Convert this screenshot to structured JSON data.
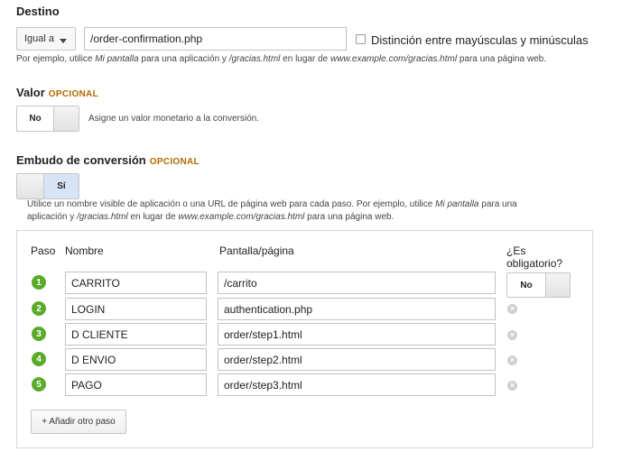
{
  "destination": {
    "title": "Destino",
    "match_type": "Igual a",
    "url_value": "/order-confirmation.php",
    "case_sensitive_label": "Distinción entre mayúsculas y minúsculas",
    "help_prefix": "Por ejemplo, utilice ",
    "help_em1": "Mi pantalla",
    "help_mid1": " para una aplicación y ",
    "help_em2": "/gracias.html",
    "help_mid2": " en lugar de ",
    "help_em3": "www.example.com/gracias.html",
    "help_suffix": " para una página web."
  },
  "value": {
    "title": "Valor",
    "optional": "OPCIONAL",
    "toggle_label": "No",
    "help": "Asigne un valor monetario a la conversión."
  },
  "funnel": {
    "title": "Embudo de conversión",
    "optional": "OPCIONAL",
    "toggle_label": "Sí",
    "help_line1_prefix": "Utilice un nombre visible de aplicación o una URL de página web para cada paso. Por ejemplo, utilice ",
    "help_line1_em": "Mi pantalla",
    "help_line1_suffix": " para una",
    "help_line2_prefix": "aplicación y ",
    "help_line2_em1": "/gracias.html",
    "help_line2_mid": " en lugar de ",
    "help_line2_em2": "www.example.com/gracias.html",
    "help_line2_suffix": " para una página web.",
    "columns": {
      "step": "Paso",
      "name": "Nombre",
      "screen": "Pantalla/página",
      "required_1": "¿Es",
      "required_2": "obligatorio?"
    },
    "required_toggle_label": "No",
    "steps": [
      {
        "num": "1",
        "name": "CARRITO",
        "page": "/carrito"
      },
      {
        "num": "2",
        "name": "LOGIN",
        "page": "authentication.php"
      },
      {
        "num": "3",
        "name": "D CLIENTE",
        "page": "order/step1.html"
      },
      {
        "num": "4",
        "name": "D ENVIO",
        "page": "order/step2.html"
      },
      {
        "num": "5",
        "name": "PAGO",
        "page": "order/step3.html"
      }
    ],
    "add_step_label": "+ Añadir otro paso"
  }
}
